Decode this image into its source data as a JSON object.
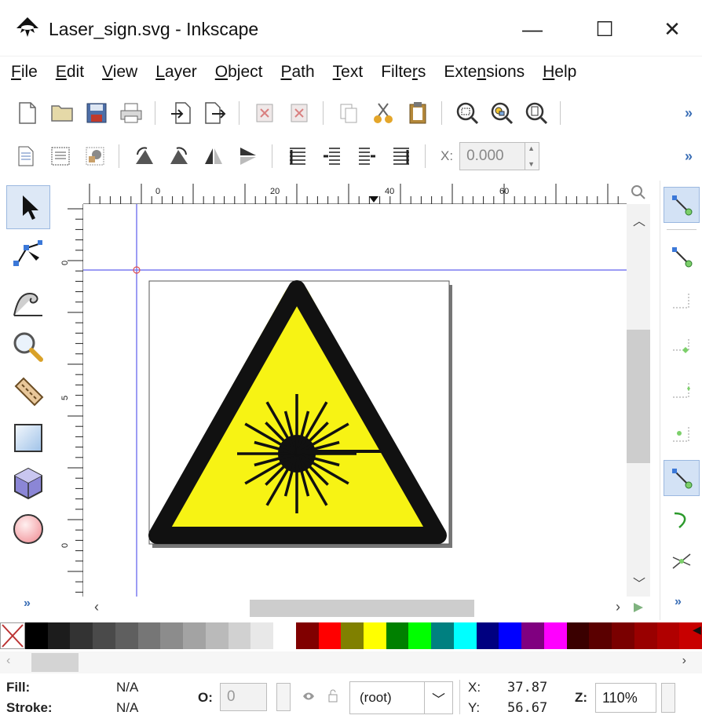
{
  "window": {
    "title": "Laser_sign.svg - Inkscape",
    "minimize": "—",
    "maximize": "☐",
    "close": "✕"
  },
  "menu": [
    {
      "label_pre": "",
      "acc": "F",
      "label_post": "ile"
    },
    {
      "label_pre": "",
      "acc": "E",
      "label_post": "dit"
    },
    {
      "label_pre": "",
      "acc": "V",
      "label_post": "iew"
    },
    {
      "label_pre": "",
      "acc": "L",
      "label_post": "ayer"
    },
    {
      "label_pre": "",
      "acc": "O",
      "label_post": "bject"
    },
    {
      "label_pre": "",
      "acc": "P",
      "label_post": "ath"
    },
    {
      "label_pre": "",
      "acc": "T",
      "label_post": "ext"
    },
    {
      "label_pre": "Filte",
      "acc": "r",
      "label_post": "s"
    },
    {
      "label_pre": "Exte",
      "acc": "n",
      "label_post": "sions"
    },
    {
      "label_pre": "",
      "acc": "H",
      "label_post": "elp"
    }
  ],
  "toolbar2": {
    "x_label": "X:",
    "x_value": "0.000"
  },
  "more_glyph": "»",
  "rulers": {
    "h_labels": [
      "0",
      "20",
      "40",
      "60"
    ],
    "v_labels": [
      "0",
      "5",
      "0"
    ]
  },
  "colors": {
    "sign_yellow": "#f7f314",
    "sign_black": "#111111",
    "guide": "#7b7bf0",
    "accent": "#3c6fb6"
  },
  "palette": [
    "#000000",
    "#1c1c1c",
    "#333333",
    "#4a4a4a",
    "#5f5f5f",
    "#767676",
    "#8c8c8c",
    "#a3a3a3",
    "#bababa",
    "#d1d1d1",
    "#e8e8e8",
    "#ffffff",
    "#800000",
    "#ff0000",
    "#808000",
    "#ffff00",
    "#008000",
    "#00ff00",
    "#008080",
    "#00ffff",
    "#000080",
    "#0000ff",
    "#800080",
    "#ff00ff",
    "#3a0000",
    "#5a0000",
    "#7a0000",
    "#990000",
    "#b00000",
    "#c80000"
  ],
  "status": {
    "fill_label": "Fill:",
    "fill_value": "N/A",
    "stroke_label": "Stroke:",
    "stroke_value": "N/A",
    "opacity_label": "O:",
    "opacity_value": "0",
    "layer": "(root)",
    "x_label": "X:",
    "x_value": "37.87",
    "y_label": "Y:",
    "y_value": "56.67",
    "zoom_label": "Z:",
    "zoom_value": "110%"
  }
}
